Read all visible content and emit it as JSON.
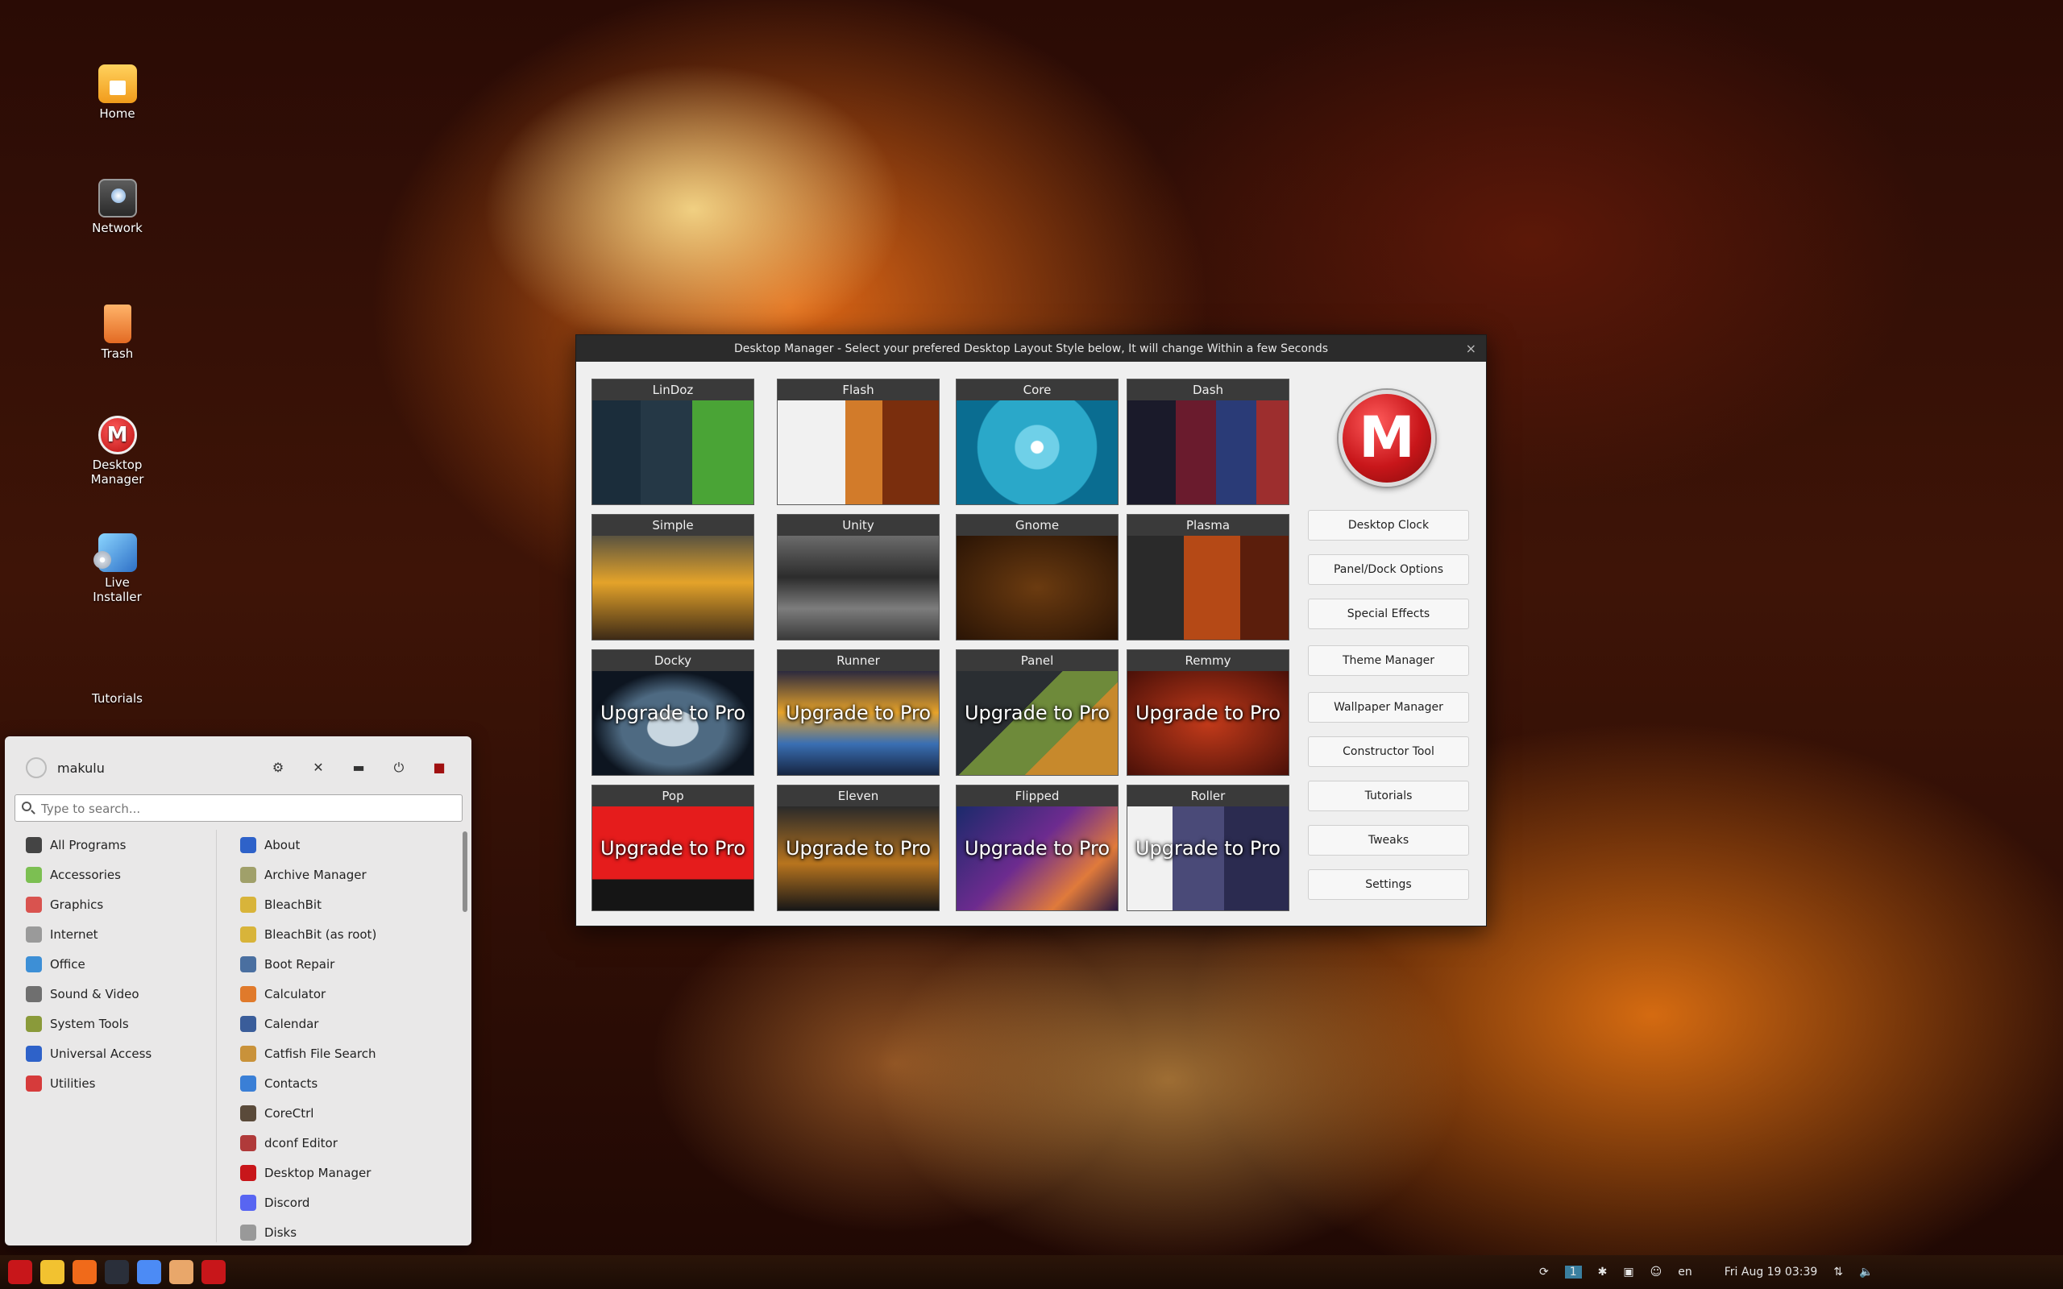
{
  "desktop_icons": [
    {
      "label": "Home",
      "icon": "home-folder-icon"
    },
    {
      "label": "Network",
      "icon": "network-icon"
    },
    {
      "label": "Trash",
      "icon": "trash-icon"
    },
    {
      "label": "Desktop Manager",
      "icon": "makulu-logo-icon"
    },
    {
      "label": "Live Installer",
      "icon": "installer-icon"
    },
    {
      "label": "Tutorials",
      "icon": "none"
    }
  ],
  "dm_window": {
    "title": "Desktop Manager - Select your prefered Desktop Layout Style below, It will change Within a few Seconds",
    "close": "×",
    "logo_letter": "M",
    "upgrade_text": "Upgrade to Pro",
    "layouts": [
      {
        "name": "LinDoz",
        "pro": false
      },
      {
        "name": "Flash",
        "pro": false
      },
      {
        "name": "Core",
        "pro": false
      },
      {
        "name": "Dash",
        "pro": false
      },
      {
        "name": "Simple",
        "pro": false
      },
      {
        "name": "Unity",
        "pro": false
      },
      {
        "name": "Gnome",
        "pro": false
      },
      {
        "name": "Plasma",
        "pro": false
      },
      {
        "name": "Docky",
        "pro": true
      },
      {
        "name": "Runner",
        "pro": true
      },
      {
        "name": "Panel",
        "pro": true
      },
      {
        "name": "Remmy",
        "pro": true
      },
      {
        "name": "Pop",
        "pro": true
      },
      {
        "name": "Eleven",
        "pro": true
      },
      {
        "name": "Flipped",
        "pro": true
      },
      {
        "name": "Roller",
        "pro": true
      }
    ],
    "side_buttons": [
      "Desktop Clock",
      "Panel/Dock Options",
      "Special Effects",
      "Theme Manager",
      "Wallpaper Manager",
      "Constructor Tool",
      "Tutorials",
      "Tweaks",
      "Settings"
    ]
  },
  "menu": {
    "username": "makulu",
    "search_placeholder": "Type to search...",
    "categories": [
      {
        "label": "All Programs",
        "icon": "grid-icon",
        "color": "#444444"
      },
      {
        "label": "Accessories",
        "icon": "accessories-icon",
        "color": "#7cbf52"
      },
      {
        "label": "Graphics",
        "icon": "graphics-icon",
        "color": "#d9534f"
      },
      {
        "label": "Internet",
        "icon": "internet-icon",
        "color": "#9a9a9a"
      },
      {
        "label": "Office",
        "icon": "office-icon",
        "color": "#3d8fd6"
      },
      {
        "label": "Sound & Video",
        "icon": "sound-video-icon",
        "color": "#6f6f6f"
      },
      {
        "label": "System Tools",
        "icon": "system-tools-icon",
        "color": "#8a9a3a"
      },
      {
        "label": "Universal Access",
        "icon": "universal-access-icon",
        "color": "#2e62c9"
      },
      {
        "label": "Utilities",
        "icon": "utilities-icon",
        "color": "#d63b3b"
      }
    ],
    "programs": [
      {
        "label": "About",
        "icon": "info-icon",
        "color": "#2e62c9"
      },
      {
        "label": "Archive Manager",
        "icon": "archive-icon",
        "color": "#a0a06a"
      },
      {
        "label": "BleachBit",
        "icon": "bleachbit-icon",
        "color": "#d8b43a"
      },
      {
        "label": "BleachBit (as root)",
        "icon": "bleachbit-root-icon",
        "color": "#d8b43a"
      },
      {
        "label": "Boot Repair",
        "icon": "boot-repair-icon",
        "color": "#4a6fa0"
      },
      {
        "label": "Calculator",
        "icon": "calculator-icon",
        "color": "#e07a2b"
      },
      {
        "label": "Calendar",
        "icon": "calendar-icon",
        "color": "#3a5d9a"
      },
      {
        "label": "Catfish File Search",
        "icon": "catfish-icon",
        "color": "#c9923a"
      },
      {
        "label": "Contacts",
        "icon": "contacts-icon",
        "color": "#3a7fd6"
      },
      {
        "label": "CoreCtrl",
        "icon": "corectrl-icon",
        "color": "#5a4a3a"
      },
      {
        "label": "dconf Editor",
        "icon": "dconf-icon",
        "color": "#b03a3a"
      },
      {
        "label": "Desktop Manager",
        "icon": "makulu-icon",
        "color": "#c8161a"
      },
      {
        "label": "Discord",
        "icon": "discord-icon",
        "color": "#5865f2"
      },
      {
        "label": "Disks",
        "icon": "disks-icon",
        "color": "#999999"
      }
    ]
  },
  "taskbar": {
    "apps": [
      {
        "name": "makulu-menu-icon",
        "color": "#c8161a"
      },
      {
        "name": "notes-icon",
        "color": "#f2c230"
      },
      {
        "name": "software-center-icon",
        "color": "#f06a1a"
      },
      {
        "name": "terminal-icon",
        "color": "#2a2f3a"
      },
      {
        "name": "chrome-icon",
        "color": "#4c8bf5"
      },
      {
        "name": "user-app-icon",
        "color": "#e9a76a"
      },
      {
        "name": "desktop-manager-task-icon",
        "color": "#c8161a"
      }
    ],
    "workspace": "1",
    "keyboard_layout": "en",
    "clock": "Fri Aug 19  03:39"
  }
}
